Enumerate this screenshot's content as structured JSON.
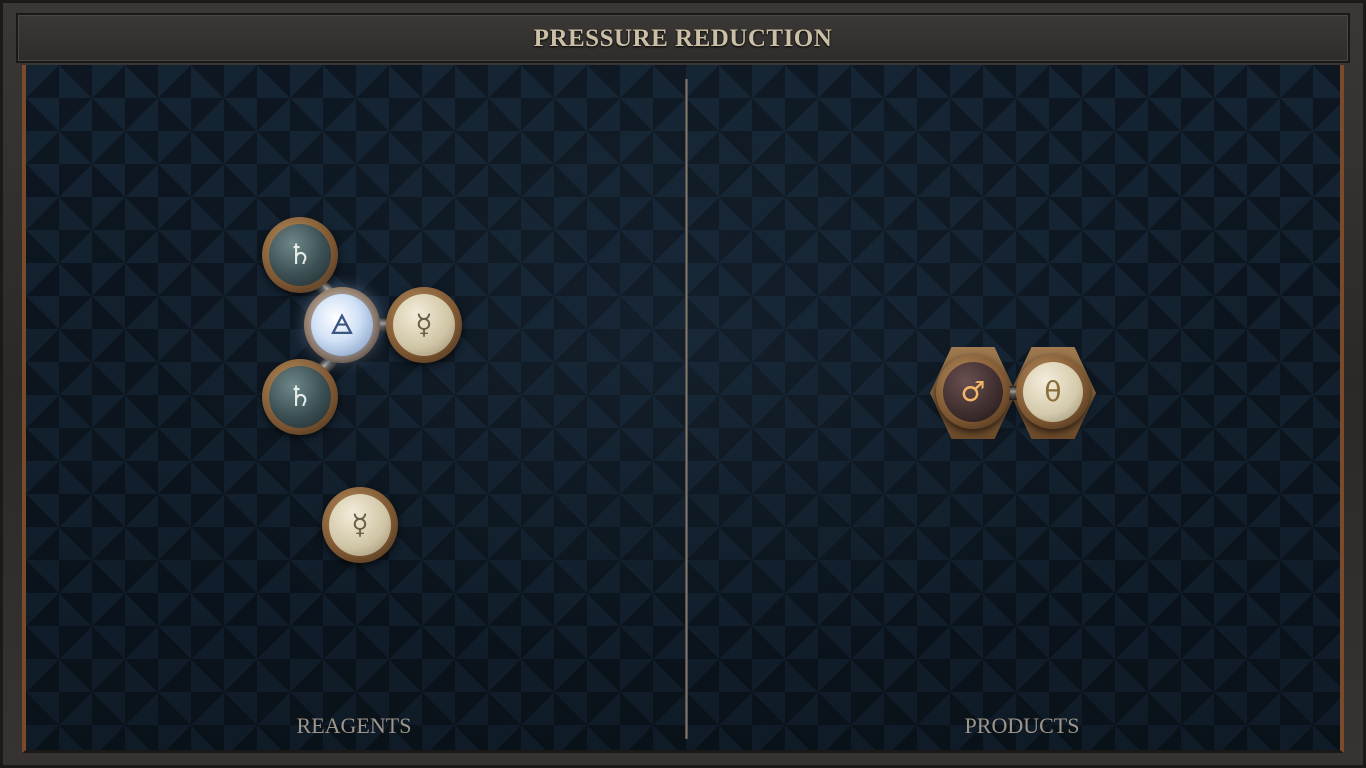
{
  "window": {
    "title": "PRESSURE REDUCTION"
  },
  "sections": {
    "reagents_label": "REAGENTS",
    "products_label": "PRODUCTS"
  },
  "reagents": {
    "molecule_1": {
      "atoms": [
        {
          "element": "salt",
          "symbol": "♄"
        },
        {
          "element": "salt",
          "symbol": "♄"
        },
        {
          "element": "air",
          "symbol": "🜁"
        },
        {
          "element": "mercury",
          "symbol": "☿"
        }
      ]
    },
    "molecule_2": {
      "atoms": [
        {
          "element": "mercury",
          "symbol": "☿"
        }
      ]
    }
  },
  "products": {
    "molecule_1": {
      "atoms": [
        {
          "element": "iron",
          "symbol": "♂"
        },
        {
          "element": "vitae",
          "symbol": "θ"
        }
      ]
    }
  },
  "colors": {
    "board_bg": "#122030",
    "frame_copper": "#7a4a2a",
    "title_text": "#cbbfa6",
    "label_text": "#9e958a"
  }
}
